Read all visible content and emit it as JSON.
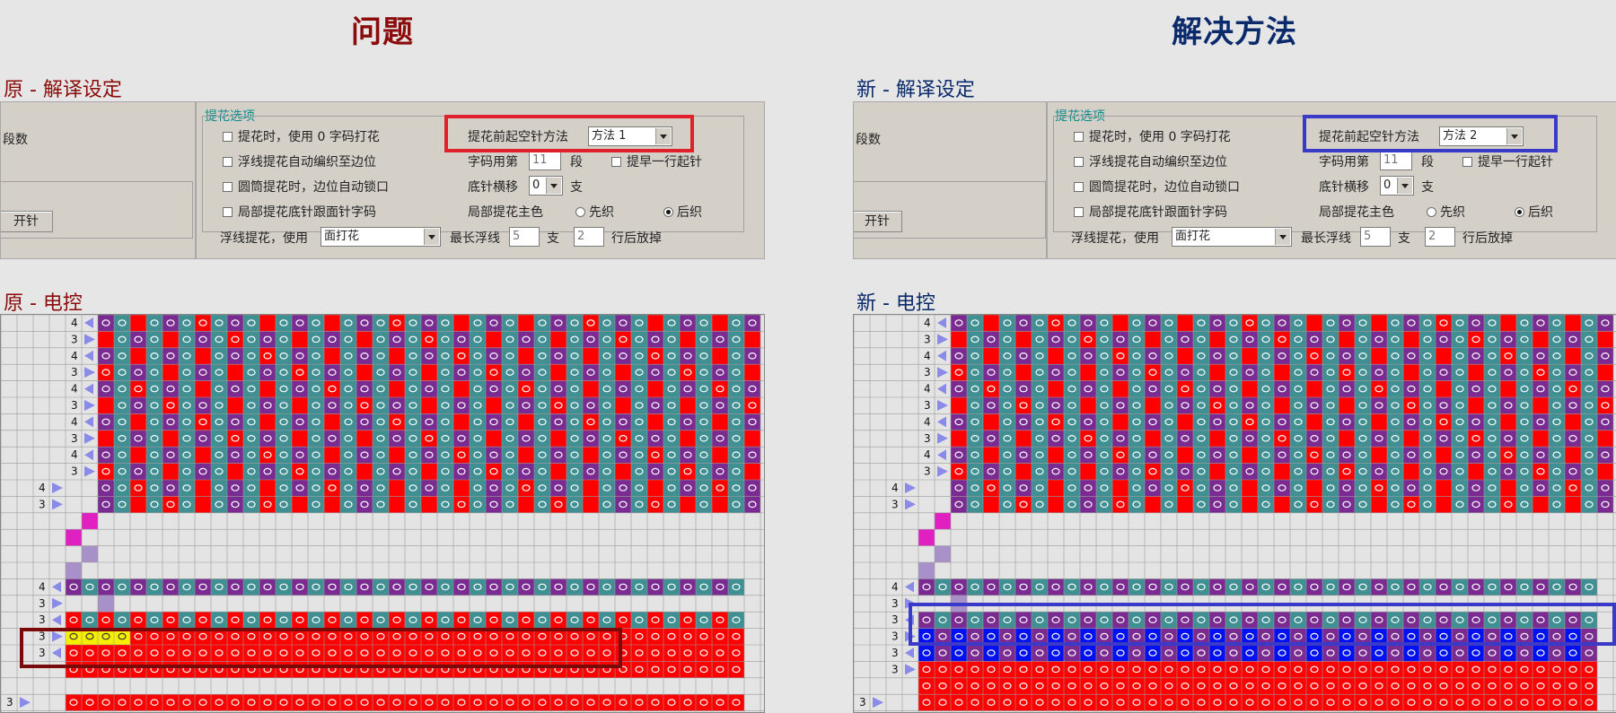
{
  "titles": {
    "problem": "问题",
    "solution": "解决方法"
  },
  "left": {
    "settings_label": "原 - 解译设定",
    "control_label": "原 - 电控",
    "method_value": "方法 1",
    "row_numbers_top": [
      "4",
      "3",
      "4",
      "3",
      "4",
      "3",
      "4",
      "3",
      "4",
      "3"
    ],
    "row_numbers_mid": [
      "4",
      "3"
    ],
    "row_numbers_lower": [
      "4",
      "3",
      "3",
      "3",
      "3"
    ],
    "row_number_bottom": "3"
  },
  "right": {
    "settings_label": "新 - 解译设定",
    "control_label": "新 - 电控",
    "method_value": "方法 2",
    "row_numbers_top": [
      "4",
      "3",
      "4",
      "3",
      "4",
      "3",
      "4",
      "3",
      "4",
      "3"
    ],
    "row_numbers_mid": [
      "4",
      "3"
    ],
    "row_numbers_lower": [
      "4",
      "3",
      "3",
      "3",
      "3",
      "3"
    ],
    "row_number_bottom": "3"
  },
  "settings": {
    "partial_count_label": "段数",
    "open_needle_btn": "开针",
    "jacquard_group_title": "提花选项",
    "cb1": "提花时，使用 0 字码打花",
    "cb2": "浮线提花自动编织至边位",
    "cb3": "圆筒提花时，边位自动锁口",
    "cb4": "局部提花底针跟面针字码",
    "method_label": "提花前起空针方法",
    "code_label": "字码用第",
    "code_value": "11",
    "code_unit": "段",
    "early_label": "提早一行起针",
    "rack_label": "底针横移",
    "rack_value": "0",
    "rack_unit": "支",
    "main_color_label": "局部提花主色",
    "radio_first": "先织",
    "radio_after": "后织",
    "float_label": "浮线提花，使用",
    "float_value": "面打花",
    "longest_float_label": "最长浮线",
    "longest_float_value": "5",
    "longest_float_unit": "支",
    "drop_value": "2",
    "drop_label": "行后放掉"
  },
  "colors": {
    "problem_title": "#8b0b0b",
    "solution_title": "#0b2a6b",
    "problem_box": "#e0202a",
    "solution_box": "#3a3ac8",
    "dark_red_box": "#7a0a0a",
    "purple": "#7a2a90",
    "teal": "#3f8f93",
    "red": "#ff0000",
    "blue": "#0010ee",
    "yellow": "#f6f000",
    "green": "#10c810",
    "magenta": "#e020c0",
    "lavender": "#a890c8",
    "arrow_blue": "#8a8ae8"
  },
  "chart_data": [
    {
      "type": "table",
      "name": "原 - 电控",
      "grid_rows": 24,
      "row_numbers": [
        "4",
        "3",
        "4",
        "3",
        "4",
        "3",
        "4",
        "3",
        "4",
        "3",
        "4",
        "3",
        "4",
        "3"
      ]
    },
    {
      "type": "table",
      "name": "新 - 电控",
      "grid_rows": 24,
      "row_numbers": [
        "4",
        "3",
        "4",
        "3",
        "4",
        "3",
        "4",
        "3",
        "4",
        "3",
        "4",
        "3",
        "4",
        "3",
        "3",
        "3",
        "3",
        "3"
      ]
    }
  ]
}
